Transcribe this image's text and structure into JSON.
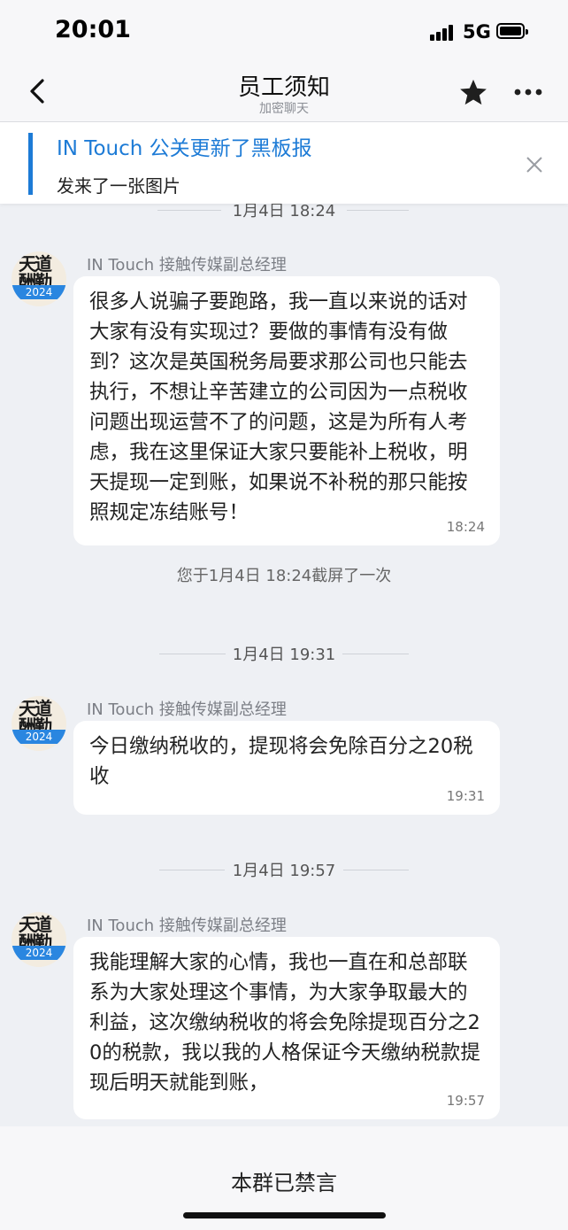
{
  "status": {
    "time": "20:01",
    "network": "5G"
  },
  "header": {
    "title": "员工须知",
    "subtitle": "加密聊天",
    "icons": {
      "back": "chevron-left-icon",
      "favorite": "star-icon",
      "more": "more-dots-icon"
    }
  },
  "notice": {
    "title": "IN Touch 公关更新了黑板报",
    "body": "发来了一张图片",
    "accent_color": "#1d7bd6"
  },
  "chat": {
    "dividers": [
      "1月4日 18:24",
      "1月4日 19:31",
      "1月4日 19:57"
    ],
    "system_notes": [
      "您于1月4日 18:24截屏了一次"
    ],
    "messages": [
      {
        "sender": "IN Touch 接触传媒副总经理",
        "avatar": {
          "calligraphy": "天道酬勤",
          "year": "2024"
        },
        "text": "很多人说骗子要跑路，我一直以来说的话对大家有没有实现过？要做的事情有没有做到？这次是英国税务局要求那公司也只能去执行，不想让辛苦建立的公司因为一点税收问题出现运营不了的问题，这是为所有人考虑，我在这里保证大家只要能补上税收，明天提现一定到账，如果说不补税的那只能按照规定冻结账号！",
        "time": "18:24"
      },
      {
        "sender": "IN Touch 接触传媒副总经理",
        "avatar": {
          "calligraphy": "天道酬勤",
          "year": "2024"
        },
        "text": "今日缴纳税收的，提现将会免除百分之20税收",
        "time": "19:31"
      },
      {
        "sender": "IN Touch 接触传媒副总经理",
        "avatar": {
          "calligraphy": "天道酬勤",
          "year": "2024"
        },
        "text": "我能理解大家的心情，我也一直在和总部联系为大家处理这个事情，为大家争取最大的利益，这次缴纳税收的将会免除提现百分之20的税款，我以我的人格保证今天缴纳税款提现后明天就能到账，",
        "time": "19:57"
      }
    ]
  },
  "footer": {
    "muted_text": "本群已禁言"
  }
}
